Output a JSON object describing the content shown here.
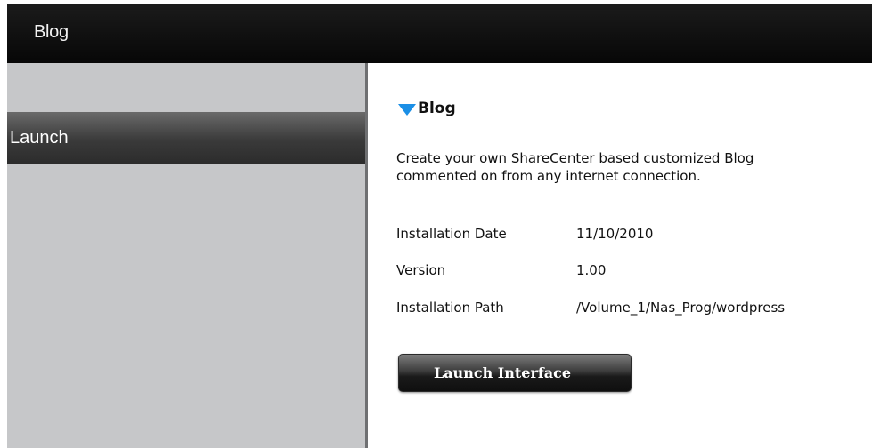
{
  "header": {
    "title": "Blog"
  },
  "sidebar": {
    "items": [
      {
        "label": "Launch"
      }
    ]
  },
  "main": {
    "section_title": "Blog",
    "description_line1": "Create your own ShareCenter based customized Blog",
    "description_line2": "commented on from any internet connection.",
    "info": [
      {
        "label": "Installation Date",
        "value": "11/10/2010"
      },
      {
        "label": "Version",
        "value": "1.00"
      },
      {
        "label": "Installation Path",
        "value": "/Volume_1/Nas_Prog/wordpress"
      }
    ],
    "launch_button_label": "Launch Interface"
  },
  "colors": {
    "accent": "#1b8fe6",
    "header_bg": "#111111",
    "sidebar_bg": "#c6c7c9"
  },
  "icons": {
    "section_toggle": "triangle-down-icon"
  }
}
